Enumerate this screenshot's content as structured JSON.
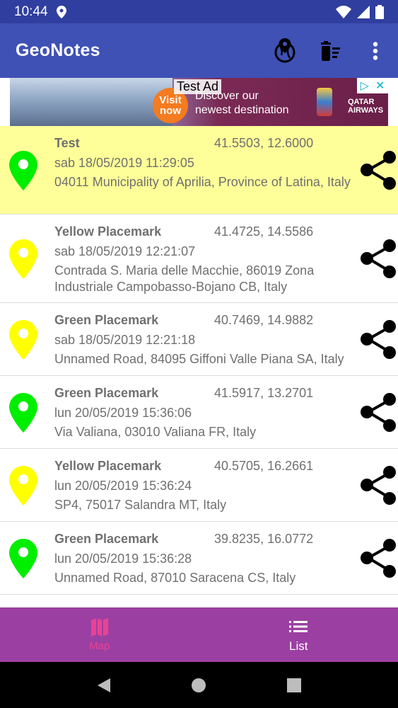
{
  "status_bar": {
    "time": "10:44"
  },
  "app_bar": {
    "title": "GeoNotes"
  },
  "ad": {
    "label": "Test Ad",
    "visit_line1": "Visit",
    "visit_line2": "now",
    "text_line1": "Discover our",
    "text_line2": "newest destination",
    "brand_line1": "QATAR",
    "brand_line2": "AIRWAYS"
  },
  "placemarks": [
    {
      "name": "Test",
      "coords": "41.5503, 12.6000",
      "date": "sab 18/05/2019 11:29:05",
      "address": "04011 Municipality of Aprilia, Province of Latina, Italy",
      "pin_color": "#00ee00",
      "selected": true
    },
    {
      "name": "Yellow Placemark",
      "coords": "41.4725, 14.5586",
      "date": "sab 18/05/2019 12:21:07",
      "address": "Contrada S. Maria delle Macchie, 86019 Zona Industriale Campobasso-Bojano CB, Italy",
      "pin_color": "#ffff00",
      "selected": false
    },
    {
      "name": "Green Placemark",
      "coords": "40.7469, 14.9882",
      "date": "sab 18/05/2019 12:21:18",
      "address": "Unnamed Road, 84095 Giffoni Valle Piana SA, Italy",
      "pin_color": "#ffff00",
      "selected": false
    },
    {
      "name": "Green Placemark",
      "coords": "41.5917, 13.2701",
      "date": "lun 20/05/2019 15:36:06",
      "address": "Via Valiana, 03010 Valiana FR, Italy",
      "pin_color": "#00ee00",
      "selected": false
    },
    {
      "name": "Yellow Placemark",
      "coords": "40.5705, 16.2661",
      "date": "lun 20/05/2019 15:36:24",
      "address": "SP4, 75017 Salandra MT, Italy",
      "pin_color": "#ffff00",
      "selected": false
    },
    {
      "name": "Green Placemark",
      "coords": "39.8235, 16.0772",
      "date": "lun 20/05/2019 15:36:28",
      "address": "Unnamed Road, 87010 Saracena CS, Italy",
      "pin_color": "#00ee00",
      "selected": false
    }
  ],
  "bottom_nav": {
    "map_label": "Map",
    "list_label": "List"
  },
  "colors": {
    "primary": "#3f51b5",
    "primary_dark": "#303f9f",
    "bottom_nav": "#9c3fa2",
    "active_tab": "#e84393",
    "selected_row": "#ffff99"
  },
  "icons": {
    "toolbar": [
      "location-globe-icon",
      "delete-sweep-icon",
      "more-vert-icon"
    ],
    "row": [
      "map-pin-icon",
      "share-icon"
    ],
    "nav": [
      "map-icon",
      "list-icon"
    ]
  }
}
